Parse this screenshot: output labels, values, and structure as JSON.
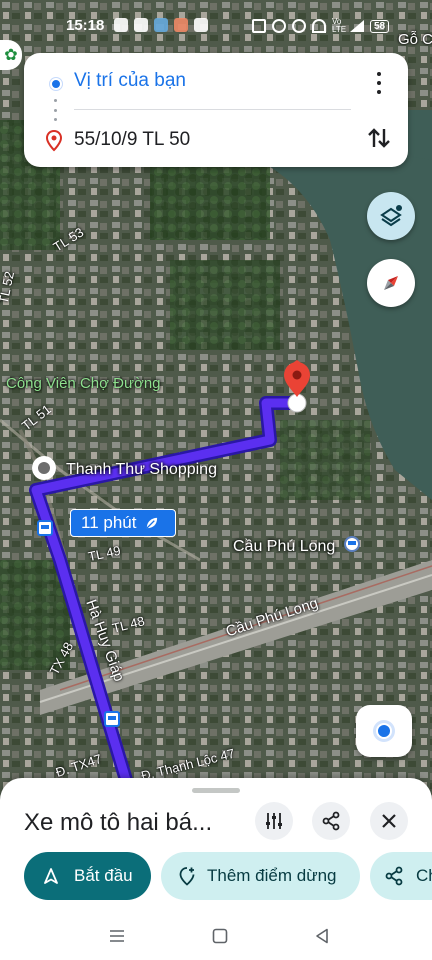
{
  "status_bar": {
    "time": "15:18",
    "network": "Vo LTE",
    "battery": "58"
  },
  "route_card": {
    "origin": "Vị trí của bạn",
    "destination": "55/10/9 TL 50"
  },
  "map": {
    "labels": {
      "go_cong": "Gỗ C",
      "tl53": "TL 53",
      "tl52": "TL 52",
      "tl51": "TL 51",
      "tl49": "TL 49",
      "tl48": "TL 48",
      "tx48": "TX 48",
      "tx47": "Đ. TX47",
      "thanh_loc_47": "Đ. Thạnh Lộc 47",
      "ha_huy_giap": "Hà Huy Giáp",
      "cau_phu_long_road": "Cầu Phú Long",
      "park": "Công Viên Chợ Đường",
      "shop": "Thanh Thư Shopping",
      "bridge_poi": "Cầu Phú Long"
    },
    "duration_badge": "11 phút",
    "colors": {
      "route": "#5b2ff0",
      "route_outline": "#2a17a6",
      "destination_pin": "#ea4335",
      "river": "#3f5e57"
    }
  },
  "sheet": {
    "mode_title": "Xe mô tô hai bá...",
    "buttons": {
      "start": "Bắt đầu",
      "add_stop": "Thêm điểm dừng",
      "share": "Ch"
    }
  },
  "icons": {
    "more": "more-vert-icon",
    "swap": "swap-vert-icon",
    "layers": "layers-icon",
    "compass": "compass-icon",
    "filter": "tune-icon",
    "share": "share-icon",
    "close": "close-icon",
    "navigate": "navigation-icon",
    "add_stop": "add-location-icon"
  }
}
